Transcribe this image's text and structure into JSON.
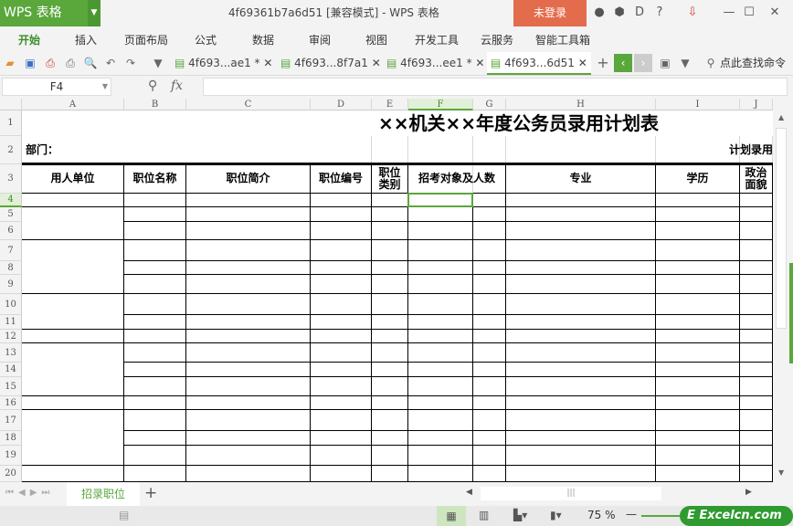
{
  "app": {
    "name": "WPS 表格",
    "doc_title": "4f69361b7a6d51 [兼容模式] - WPS 表格",
    "login": "未登录"
  },
  "menu": [
    "开始",
    "插入",
    "页面布局",
    "公式",
    "数据",
    "审阅",
    "视图",
    "开发工具",
    "云服务",
    "智能工具箱"
  ],
  "doc_tabs": [
    {
      "label": "4f693...ae1 *"
    },
    {
      "label": "4f693...8f7a1"
    },
    {
      "label": "4f693...ee1 *"
    },
    {
      "label": "4f693...6d51",
      "active": true
    }
  ],
  "search_cmd": "点此查找命令",
  "formula": {
    "name_box": "F4",
    "fx": "fx",
    "value": ""
  },
  "columns": [
    "A",
    "B",
    "C",
    "D",
    "E",
    "F",
    "G",
    "H",
    "I",
    "J"
  ],
  "rows": [
    "1",
    "2",
    "3",
    "4",
    "5",
    "6",
    "7",
    "8",
    "9",
    "10",
    "11",
    "12",
    "13",
    "14",
    "15",
    "16",
    "17",
    "18",
    "19",
    "20"
  ],
  "sheet": {
    "title": "××机关××年度公务员录用计划表",
    "dept_label": "部门：",
    "plan_label": "计划录用",
    "headers": [
      "用人单位",
      "职位名称",
      "职位简介",
      "职位编号",
      "职位\n类别",
      "招考对象及人数",
      "专业",
      "学历",
      "政治\n面貌"
    ]
  },
  "selected_cell": "F4",
  "sheet_tabs": [
    "招录职位"
  ],
  "zoom": "75 %",
  "watermark": "Excelcn.com",
  "colors": {
    "accent": "#5aa73c",
    "login": "#e36c4d"
  }
}
